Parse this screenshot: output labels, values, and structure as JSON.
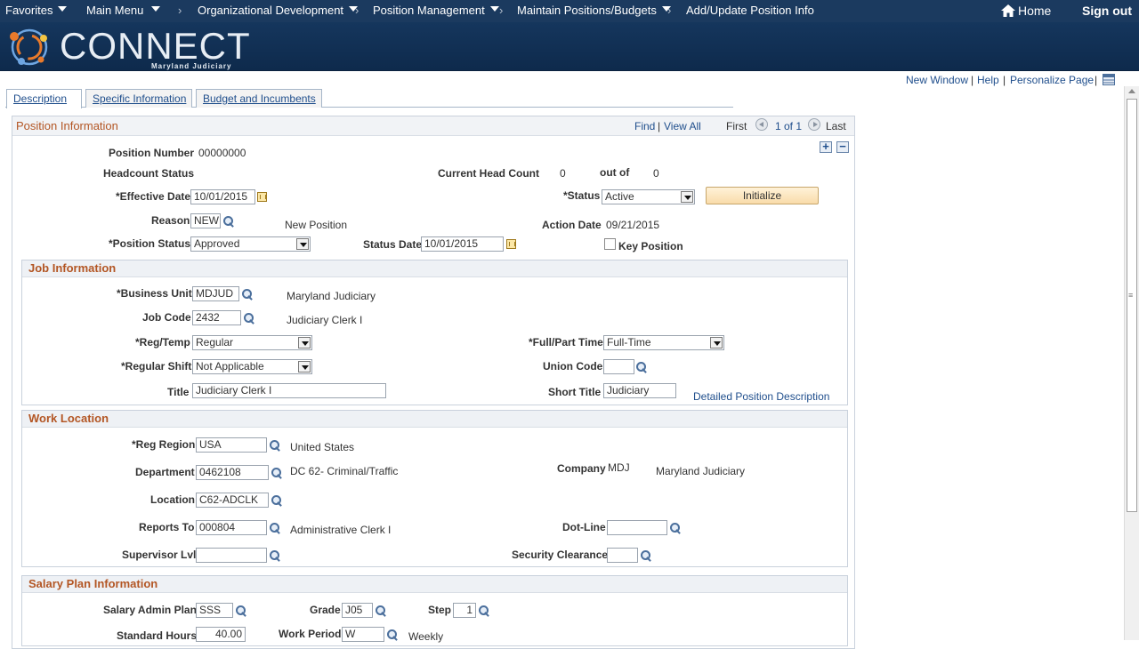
{
  "nav": {
    "favorites": "Favorites",
    "main_menu": "Main Menu",
    "org_dev": "Organizational Development",
    "position_mgmt": "Position Management",
    "maintain": "Maintain Positions/Budgets",
    "add_update": "Add/Update Position Info",
    "separator": "›",
    "home": "Home",
    "sign_out": "Sign out"
  },
  "brand": {
    "name": "CONNECT",
    "subtitle": "Maryland Judiciary"
  },
  "page_links": {
    "new_window": "New Window",
    "help": "Help",
    "personalize": "Personalize Page",
    "pipe": "|"
  },
  "tabs": [
    {
      "label": "Description",
      "active": true
    },
    {
      "label": "Specific Information",
      "active": false
    },
    {
      "label": "Budget and Incumbents",
      "active": false
    }
  ],
  "panel": {
    "title": "Position Information",
    "find": "Find",
    "pipe": "|",
    "view_all": "View All",
    "first": "First",
    "count": "1 of 1",
    "last": "Last",
    "expand": "+",
    "collapse": "−"
  },
  "position": {
    "number_label": "Position Number",
    "number_value": "00000000",
    "headcount_label": "Headcount Status",
    "current_head_label": "Current Head Count",
    "current_head_value": "0",
    "out_of_label": "out of",
    "out_of_value": "0",
    "effective_label": "*Effective Date",
    "effective_value": "10/01/2015",
    "status_label": "*Status",
    "status_value": "Active",
    "initialize": "Initialize",
    "reason_label": "Reason",
    "reason_value": "NEW",
    "reason_desc": "New Position",
    "action_date_label": "Action Date",
    "action_date_value": "09/21/2015",
    "pos_status_label": "*Position Status",
    "pos_status_value": "Approved",
    "status_date_label": "Status Date",
    "status_date_value": "10/01/2015",
    "key_position_label": "Key Position"
  },
  "job": {
    "title": "Job Information",
    "bu_label": "*Business Unit",
    "bu_value": "MDJUD",
    "bu_desc": "Maryland Judiciary",
    "jobcode_label": "Job Code",
    "jobcode_value": "2432",
    "jobcode_desc": "Judiciary Clerk I",
    "regtemp_label": "*Reg/Temp",
    "regtemp_value": "Regular",
    "fullpart_label": "*Full/Part Time",
    "fullpart_value": "Full-Time",
    "shift_label": "*Regular Shift",
    "shift_value": "Not Applicable",
    "union_label": "Union Code",
    "union_value": "",
    "title_label": "Title",
    "title_value": "Judiciary Clerk I",
    "short_title_label": "Short Title",
    "short_title_value": "Judiciary",
    "detailed_link": "Detailed Position Description"
  },
  "work": {
    "title": "Work Location",
    "region_label": "*Reg Region",
    "region_value": "USA",
    "region_desc": "United States",
    "dept_label": "Department",
    "dept_value": "0462108",
    "dept_desc": "DC 62- Criminal/Traffic",
    "company_label": "Company",
    "company_value": "MDJ",
    "company_desc": "Maryland Judiciary",
    "location_label": "Location",
    "location_value": "C62-ADCLK",
    "reports_label": "Reports To",
    "reports_value": "000804",
    "reports_desc": "Administrative Clerk I",
    "dotline_label": "Dot-Line",
    "dotline_value": "",
    "suplvl_label": "Supervisor Lvl",
    "suplvl_value": "",
    "security_label": "Security Clearance",
    "security_value": ""
  },
  "salary": {
    "title": "Salary Plan Information",
    "plan_label": "Salary Admin Plan",
    "plan_value": "SSS",
    "grade_label": "Grade",
    "grade_value": "J05",
    "step_label": "Step",
    "step_value": "1",
    "std_hours_label": "Standard Hours",
    "std_hours_value": "40.00",
    "work_period_label": "Work Period",
    "work_period_value": "W",
    "work_period_desc": "Weekly"
  },
  "colors": {
    "topnav": "#1b3a5f",
    "section_title": "#b35624",
    "link": "#1f4e8c"
  }
}
